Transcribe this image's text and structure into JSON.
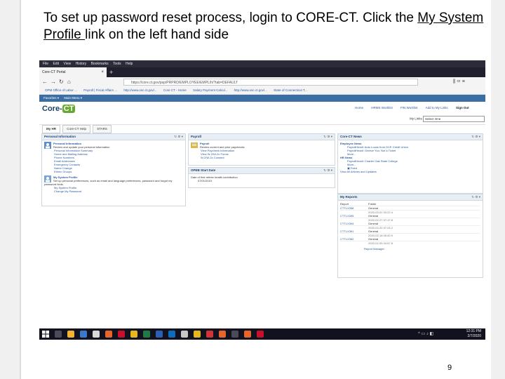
{
  "slide": {
    "title_prefix": "To set up password reset process, login to CORE-CT.  Click the",
    "title_link": "My System Profile ",
    "title_suffix": "link on the left hand side",
    "page_number": "9"
  },
  "browser": {
    "menu": [
      "File",
      "Edit",
      "View",
      "History",
      "Bookmarks",
      "Tools",
      "Help"
    ],
    "tab_title": "Core-CT Portal",
    "tab_close": "×",
    "tab_add": "+",
    "url": "https://core.ct.gov/psp/PRPRD/EMPLOYEE/EMPL/h/?tab=DEFAULT",
    "bookmarks": [
      "OPM Office of Labor ...",
      "Payroll | Fiscal Affairs ...",
      "http://www.osc.ct.gov/...",
      "Core CT - Home",
      "Salary Payment Calcul...",
      "http://www.osc.ct.gov/...",
      "State of Connecticut T..."
    ]
  },
  "portal": {
    "menu": [
      "Favorites ▾",
      "Main Menu ▾"
    ],
    "logo_core": "Core-",
    "logo_ct": "CT",
    "header_links": [
      "Home",
      "HRMS Worklist",
      "FIN Worklist",
      "Add to My Links",
      "Sign Out"
    ],
    "my_links_label": "My Links",
    "my_links_value": "Select One",
    "tabs": [
      "My HR",
      "Core-CT Help",
      "STARS"
    ],
    "personal_info": {
      "title": "Personal Information",
      "heading": "Personal Information",
      "desc": "Review and update your personal information",
      "links": [
        "Personal Information Summary",
        "Home and Mailing Address",
        "Phone Numbers",
        "Email Addresses",
        "Emergency Contacts",
        "Name Change",
        "Ethnic Groups"
      ],
      "profile_heading": "My System Profile",
      "profile_desc": "Set up personal preferences, such as email and language preferences, password and forgot my password hints.",
      "profile_links": [
        "My System Profile",
        "Change My Password"
      ]
    },
    "payroll": {
      "title": "Payroll",
      "heading": "Payroll",
      "desc": "Review current and prior paychecks",
      "links": [
        "View Paycheck Information",
        "View W-2/W-2c Forms",
        "W-2/W-2c Consent"
      ]
    },
    "opeb": {
      "title": "OPEB Start Date",
      "label": "Date of first retiree health contribution",
      "date": "07/01/2010"
    },
    "news": {
      "title": "Core-CT News",
      "employee_heading": "Employee News",
      "employee_items": [
        "PayrollHeadl: Auto Loans from DCE Credit Union",
        "PayrollHeadl: Greece You, Not a Ticket"
      ],
      "more1": "More...",
      "hr_heading": "HR News",
      "hr_items": [
        "PayrollHeadl: Charter Oak State College"
      ],
      "more2": "More...",
      "feed": "Feed",
      "all_link": "View All Articles and Updates"
    },
    "reports": {
      "title": "My Reports",
      "col_report": "Report",
      "col_folder": "Folder",
      "rows": [
        {
          "report": "CTTLX358",
          "folder": "General",
          "stamp": "2020-03-01 03:22.4"
        },
        {
          "report": "CTTLX305",
          "folder": "General",
          "stamp": "2020-02-27 07:17.8"
        },
        {
          "report": "CTTLX304",
          "folder": "General",
          "stamp": "2020-02-20 07:24.2"
        },
        {
          "report": "CTTLX361",
          "folder": "General",
          "stamp": "2020-02-18 05:40.9"
        },
        {
          "report": "CTTLX362",
          "folder": "General",
          "stamp": "2020-02-05 04:57.8"
        }
      ],
      "manager": "Report Manager"
    }
  },
  "taskbar": {
    "time": "12:31 PM",
    "date": "2/7/2020"
  },
  "colors": {
    "portal_blue": "#3b6ea5",
    "logo_green": "#66a830",
    "link_blue": "#2a5a9a"
  }
}
